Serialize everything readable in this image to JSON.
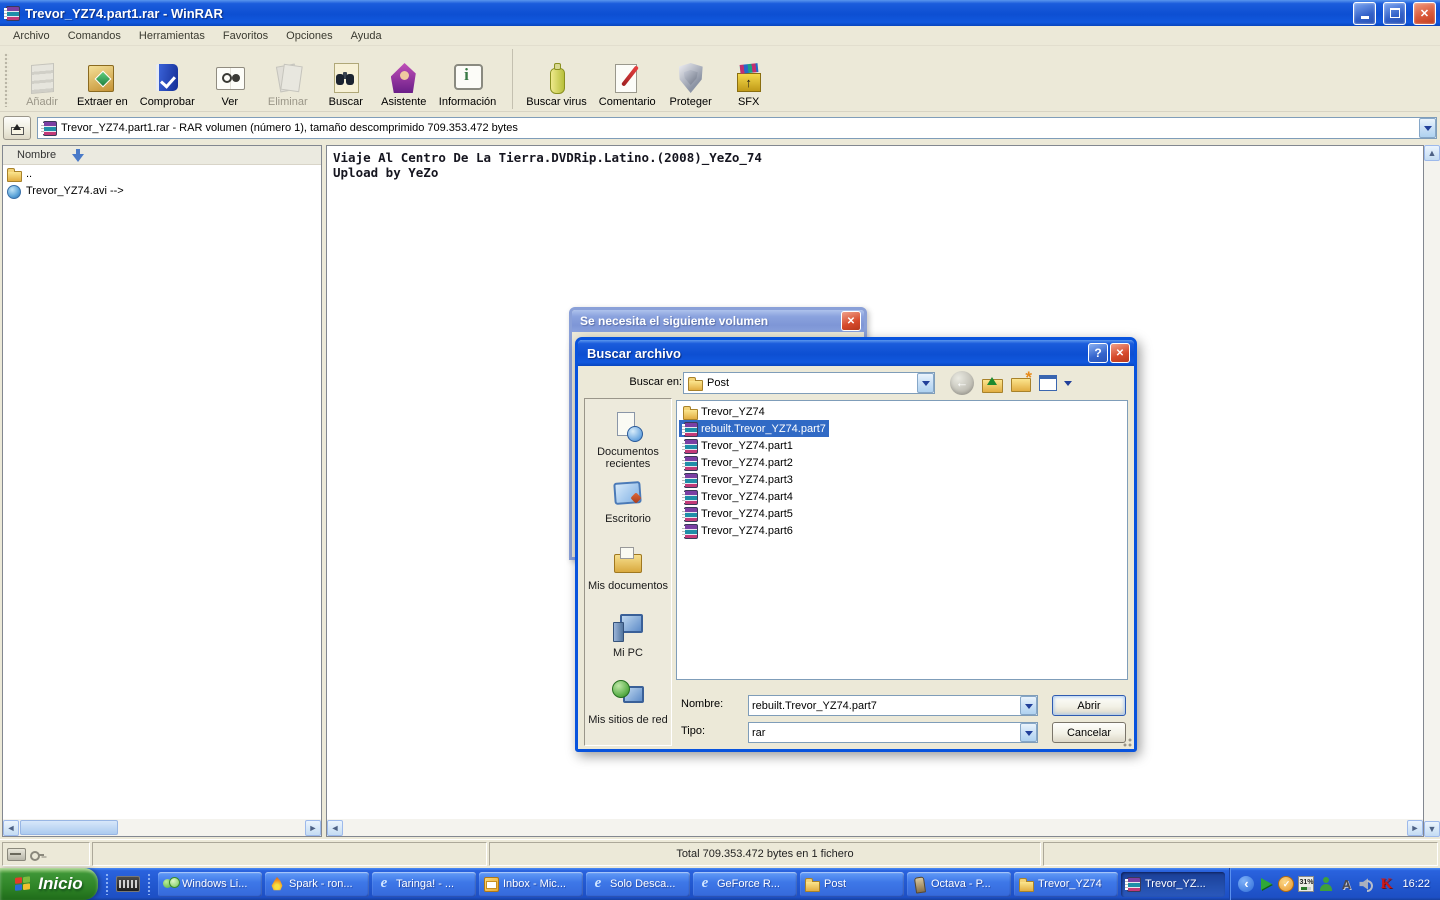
{
  "window": {
    "title": "Trevor_YZ74.part1.rar - WinRAR",
    "menu": [
      {
        "name": "menu-archivo",
        "label": "Archivo"
      },
      {
        "name": "menu-comandos",
        "label": "Comandos"
      },
      {
        "name": "menu-herramientas",
        "label": "Herramientas"
      },
      {
        "name": "menu-favoritos",
        "label": "Favoritos"
      },
      {
        "name": "menu-opciones",
        "label": "Opciones"
      },
      {
        "name": "menu-ayuda",
        "label": "Ayuda"
      }
    ],
    "toolbar": [
      {
        "name": "toolbar-button-anadir",
        "label": "Añadir",
        "icon": "add-archive-icon",
        "disabled": true
      },
      {
        "name": "toolbar-button-extraer-en",
        "label": "Extraer en",
        "icon": "extract-icon"
      },
      {
        "name": "toolbar-button-comprobar",
        "label": "Comprobar",
        "icon": "test-icon"
      },
      {
        "name": "toolbar-button-ver",
        "label": "Ver",
        "icon": "view-icon"
      },
      {
        "name": "toolbar-button-eliminar",
        "label": "Eliminar",
        "icon": "delete-icon",
        "disabled": true
      },
      {
        "name": "toolbar-button-buscar",
        "label": "Buscar",
        "icon": "find-icon"
      },
      {
        "name": "toolbar-button-asistente",
        "label": "Asistente",
        "icon": "wizard-icon"
      },
      {
        "name": "toolbar-button-informacion",
        "label": "Información",
        "icon": "info-icon"
      },
      {
        "name": "toolbar-button-buscar-virus",
        "label": "Buscar virus",
        "icon": "virus-scan-icon",
        "sep": true
      },
      {
        "name": "toolbar-button-comentario",
        "label": "Comentario",
        "icon": "comment-icon"
      },
      {
        "name": "toolbar-button-proteger",
        "label": "Proteger",
        "icon": "protect-icon"
      },
      {
        "name": "toolbar-button-sfx",
        "label": "SFX",
        "icon": "sfx-icon"
      }
    ],
    "address": "Trevor_YZ74.part1.rar - RAR volumen (número 1), tamaño descomprimido 709.353.472 bytes",
    "file_panel": {
      "column_header": "Nombre",
      "items": [
        {
          "name": "file-row-parent",
          "label": "..",
          "icon": "folder-icon"
        },
        {
          "name": "file-row-avi",
          "label": "Trevor_YZ74.avi -->",
          "icon": "avi-icon"
        }
      ]
    },
    "comment_panel": {
      "lines": [
        "Viaje Al Centro De La Tierra.DVDRip.Latino.(2008)_YeZo_74",
        "Upload by YeZo"
      ]
    },
    "status_total": "Total 709.353.472 bytes en 1 fichero"
  },
  "volume_dialog": {
    "title": "Se necesita el siguiente volumen"
  },
  "open_dialog": {
    "title": "Buscar archivo",
    "look_in_label": "Buscar en:",
    "look_in_value": "Post",
    "places": [
      {
        "name": "place-documentos-recientes",
        "label": "Documentos recientes",
        "icon": "recent-docs-icon"
      },
      {
        "name": "place-escritorio",
        "label": "Escritorio",
        "icon": "desktop-icon"
      },
      {
        "name": "place-mis-documentos",
        "label": "Mis documentos",
        "icon": "my-docs-icon"
      },
      {
        "name": "place-mi-pc",
        "label": "Mi PC",
        "icon": "my-pc-icon"
      },
      {
        "name": "place-mis-sitios-de-red",
        "label": "Mis sitios de red",
        "icon": "network-icon"
      }
    ],
    "files": [
      {
        "name": "dialog-file-trevor-folder",
        "label": "Trevor_YZ74",
        "icon": "folder-icon"
      },
      {
        "name": "dialog-file-rebuilt-part7",
        "label": "rebuilt.Trevor_YZ74.part7",
        "icon": "rar-icon",
        "selected": true
      },
      {
        "name": "dialog-file-part1",
        "label": "Trevor_YZ74.part1",
        "icon": "rar-icon"
      },
      {
        "name": "dialog-file-part2",
        "label": "Trevor_YZ74.part2",
        "icon": "rar-icon"
      },
      {
        "name": "dialog-file-part3",
        "label": "Trevor_YZ74.part3",
        "icon": "rar-icon"
      },
      {
        "name": "dialog-file-part4",
        "label": "Trevor_YZ74.part4",
        "icon": "rar-icon"
      },
      {
        "name": "dialog-file-part5",
        "label": "Trevor_YZ74.part5",
        "icon": "rar-icon"
      },
      {
        "name": "dialog-file-part6",
        "label": "Trevor_YZ74.part6",
        "icon": "rar-icon"
      }
    ],
    "name_label": "Nombre:",
    "name_value": "rebuilt.Trevor_YZ74.part7",
    "type_label": "Tipo:",
    "type_value": "rar",
    "open_button": "Abrir",
    "cancel_button": "Cancelar",
    "help_glyph": "?",
    "close_glyph": "✕"
  },
  "taskbar": {
    "start_label": "Inicio",
    "buttons": [
      {
        "name": "task-windows-live",
        "label": "Windows Li...",
        "icon": "messenger-icon"
      },
      {
        "name": "task-spark",
        "label": "Spark - ron...",
        "icon": "spark-icon"
      },
      {
        "name": "task-taringa",
        "label": "Taringa! - ...",
        "icon": "ie-icon"
      },
      {
        "name": "task-inbox",
        "label": "Inbox - Mic...",
        "icon": "outlook-icon"
      },
      {
        "name": "task-solo-desca",
        "label": "Solo Desca...",
        "icon": "ie-icon"
      },
      {
        "name": "task-geforce",
        "label": "GeForce R...",
        "icon": "ie-icon"
      },
      {
        "name": "task-post",
        "label": "Post",
        "icon": "folder-icon"
      },
      {
        "name": "task-octava",
        "label": "Octava - P...",
        "icon": "octava-icon"
      },
      {
        "name": "task-trevor-folder",
        "label": "Trevor_YZ74",
        "icon": "folder-icon"
      },
      {
        "name": "task-trevor-winrar",
        "label": "Trevor_YZ...",
        "icon": "winrar-icon",
        "active": true
      }
    ],
    "tray_icons": [
      {
        "name": "tray-chevron-icon"
      },
      {
        "name": "tray-play-icon"
      },
      {
        "name": "tray-clock-icon"
      },
      {
        "name": "tray-battery-icon",
        "label": "31%"
      },
      {
        "name": "tray-user-icon"
      },
      {
        "name": "tray-a-icon"
      },
      {
        "name": "tray-speaker-icon"
      },
      {
        "name": "tray-kaspersky-icon"
      }
    ],
    "clock": "16:22"
  }
}
